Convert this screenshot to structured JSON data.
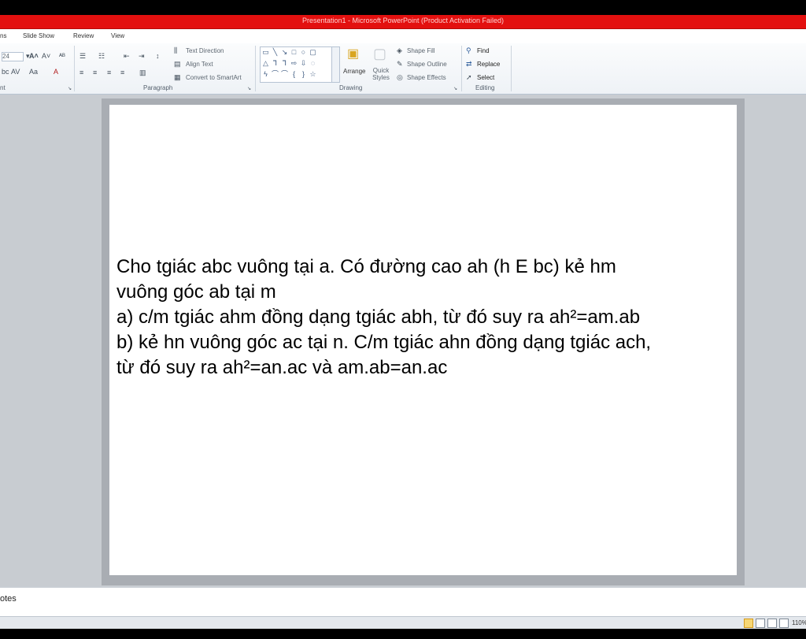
{
  "window": {
    "title": "Presentation1 - Microsoft PowerPoint (Product Activation Failed)"
  },
  "tabs": [
    {
      "label": "ns"
    },
    {
      "label": "Slide Show"
    },
    {
      "label": "Review"
    },
    {
      "label": "View"
    }
  ],
  "ribbon": {
    "font": {
      "size": "24",
      "label": "nt"
    },
    "paragraph": {
      "label": "Paragraph",
      "text_direction": "Text Direction",
      "align_text": "Align Text",
      "convert_smartart": "Convert to SmartArt"
    },
    "drawing": {
      "label": "Drawing",
      "arrange": "Arrange",
      "quick_styles": "Quick Styles",
      "shape_fill": "Shape Fill",
      "shape_outline": "Shape Outline",
      "shape_effects": "Shape Effects"
    },
    "editing": {
      "label": "Editing",
      "find": "Find",
      "replace": "Replace",
      "select": "Select"
    }
  },
  "slide": {
    "lines": [
      "Cho tgiác abc vuông tại a. Có đường cao ah (h E bc) kẻ hm",
      "vuông góc ab tại m",
      "a) c/m tgiác ahm đồng dạng tgiác abh, từ đó suy ra ah²=am.ab",
      "b) kẻ hn vuông góc ac tại n. C/m tgiác ahn đồng dạng tgiác ach,",
      "từ đó suy ra ah²=an.ac và am.ab=an.ac"
    ]
  },
  "notes": {
    "label": "otes"
  },
  "status": {
    "zoom": "110%"
  }
}
